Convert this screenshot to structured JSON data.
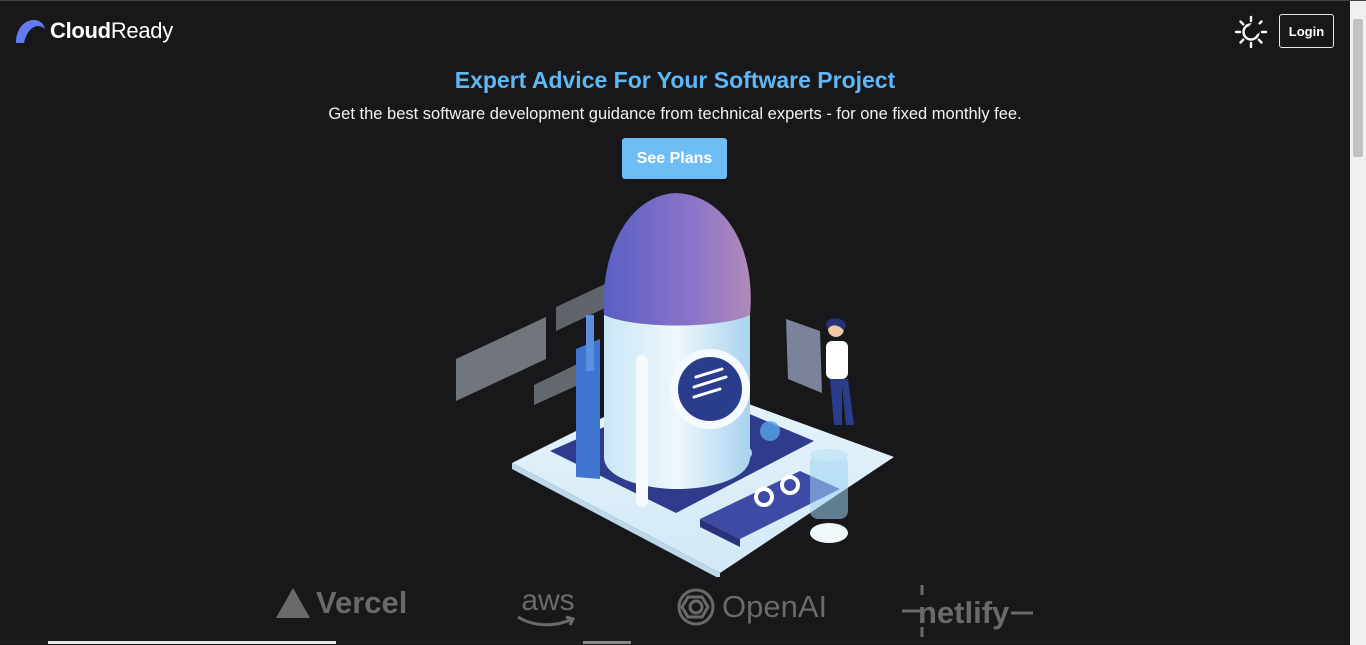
{
  "brand": {
    "bold": "Cloud",
    "light": "Ready"
  },
  "nav": {
    "login_label": "Login",
    "theme_icon": "sun-moon-icon"
  },
  "hero": {
    "title": "Expert Advice For Your Software Project",
    "subtitle": "Get the best software development guidance from technical experts - for one fixed monthly fee.",
    "cta_label": "See Plans"
  },
  "partners": [
    {
      "name": "Vercel",
      "icon": "vercel-triangle-icon"
    },
    {
      "name": "aws",
      "icon": "aws-smile-icon"
    },
    {
      "name": "OpenAI",
      "icon": "openai-knot-icon"
    },
    {
      "name": "netlify",
      "icon": "netlify-icon"
    }
  ],
  "colors": {
    "background": "#18181a",
    "accent": "#5fb8f5",
    "button": "#6fbdf5",
    "partner_logo": "#6a6a6a"
  }
}
